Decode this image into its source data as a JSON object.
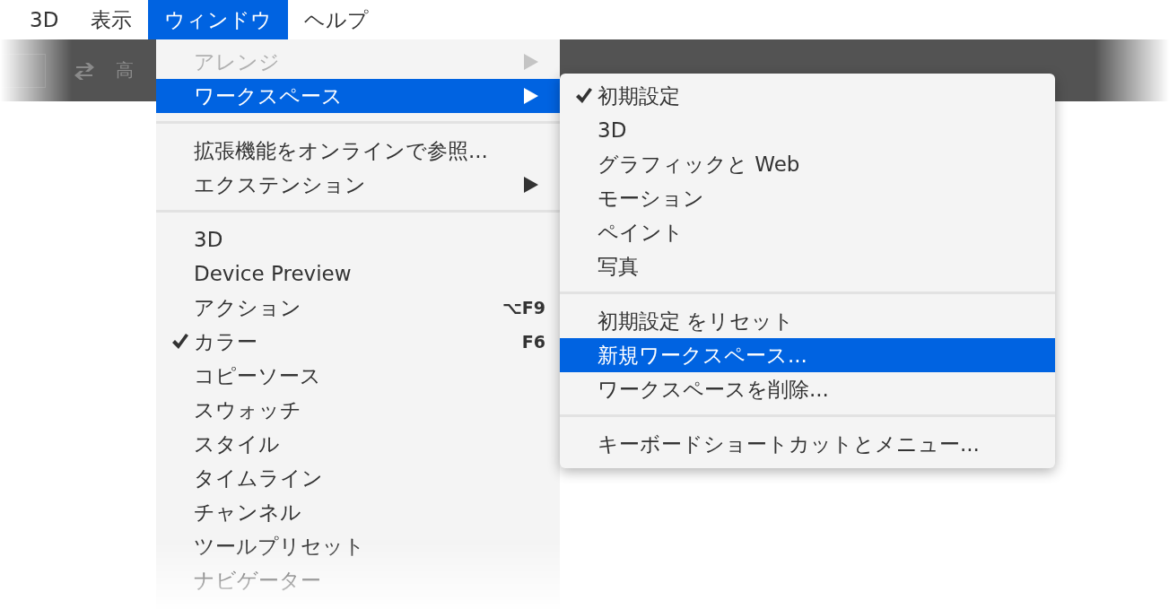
{
  "menubar": [
    {
      "label": "3D",
      "selected": false
    },
    {
      "label": "表示",
      "selected": false
    },
    {
      "label": "ウィンドウ",
      "selected": true
    },
    {
      "label": "ヘルプ",
      "selected": false
    }
  ],
  "toolbar": {
    "height_label": "高"
  },
  "menu": [
    {
      "kind": "item",
      "label": "アレンジ",
      "disabled": true,
      "submenu": true,
      "selected": false,
      "checked": false
    },
    {
      "kind": "item",
      "label": "ワークスペース",
      "disabled": false,
      "submenu": true,
      "selected": true,
      "checked": false
    },
    {
      "kind": "separator"
    },
    {
      "kind": "item",
      "label": "拡張機能をオンラインで参照...",
      "disabled": false,
      "submenu": false,
      "selected": false,
      "checked": false
    },
    {
      "kind": "item",
      "label": "エクステンション",
      "disabled": false,
      "submenu": true,
      "selected": false,
      "checked": false
    },
    {
      "kind": "separator"
    },
    {
      "kind": "item",
      "label": "3D",
      "disabled": false,
      "submenu": false,
      "selected": false,
      "checked": false
    },
    {
      "kind": "item",
      "label": "Device Preview",
      "disabled": false,
      "submenu": false,
      "selected": false,
      "checked": false
    },
    {
      "kind": "item",
      "label": "アクション",
      "disabled": false,
      "submenu": false,
      "selected": false,
      "checked": false,
      "shortcut": "⌥F9"
    },
    {
      "kind": "item",
      "label": "カラー",
      "disabled": false,
      "submenu": false,
      "selected": false,
      "checked": true,
      "shortcut": "F6"
    },
    {
      "kind": "item",
      "label": "コピーソース",
      "disabled": false,
      "submenu": false,
      "selected": false,
      "checked": false
    },
    {
      "kind": "item",
      "label": "スウォッチ",
      "disabled": false,
      "submenu": false,
      "selected": false,
      "checked": false
    },
    {
      "kind": "item",
      "label": "スタイル",
      "disabled": false,
      "submenu": false,
      "selected": false,
      "checked": false
    },
    {
      "kind": "item",
      "label": "タイムライン",
      "disabled": false,
      "submenu": false,
      "selected": false,
      "checked": false
    },
    {
      "kind": "item",
      "label": "チャンネル",
      "disabled": false,
      "submenu": false,
      "selected": false,
      "checked": false
    },
    {
      "kind": "item",
      "label": "ツールプリセット",
      "disabled": false,
      "submenu": false,
      "selected": false,
      "checked": false
    },
    {
      "kind": "item",
      "label": "ナビゲーター",
      "disabled": false,
      "submenu": false,
      "selected": false,
      "checked": false
    }
  ],
  "submenu": [
    {
      "kind": "item",
      "label": "初期設定",
      "selected": false,
      "checked": true
    },
    {
      "kind": "item",
      "label": "3D",
      "selected": false,
      "checked": false
    },
    {
      "kind": "item",
      "label": "グラフィックと Web",
      "selected": false,
      "checked": false
    },
    {
      "kind": "item",
      "label": "モーション",
      "selected": false,
      "checked": false
    },
    {
      "kind": "item",
      "label": "ペイント",
      "selected": false,
      "checked": false
    },
    {
      "kind": "item",
      "label": "写真",
      "selected": false,
      "checked": false
    },
    {
      "kind": "separator"
    },
    {
      "kind": "item",
      "label": "初期設定 をリセット",
      "selected": false,
      "checked": false
    },
    {
      "kind": "item",
      "label": "新規ワークスペース...",
      "selected": true,
      "checked": false
    },
    {
      "kind": "item",
      "label": "ワークスペースを削除...",
      "selected": false,
      "checked": false
    },
    {
      "kind": "separator"
    },
    {
      "kind": "item",
      "label": "キーボードショートカットとメニュー...",
      "selected": false,
      "checked": false
    }
  ]
}
